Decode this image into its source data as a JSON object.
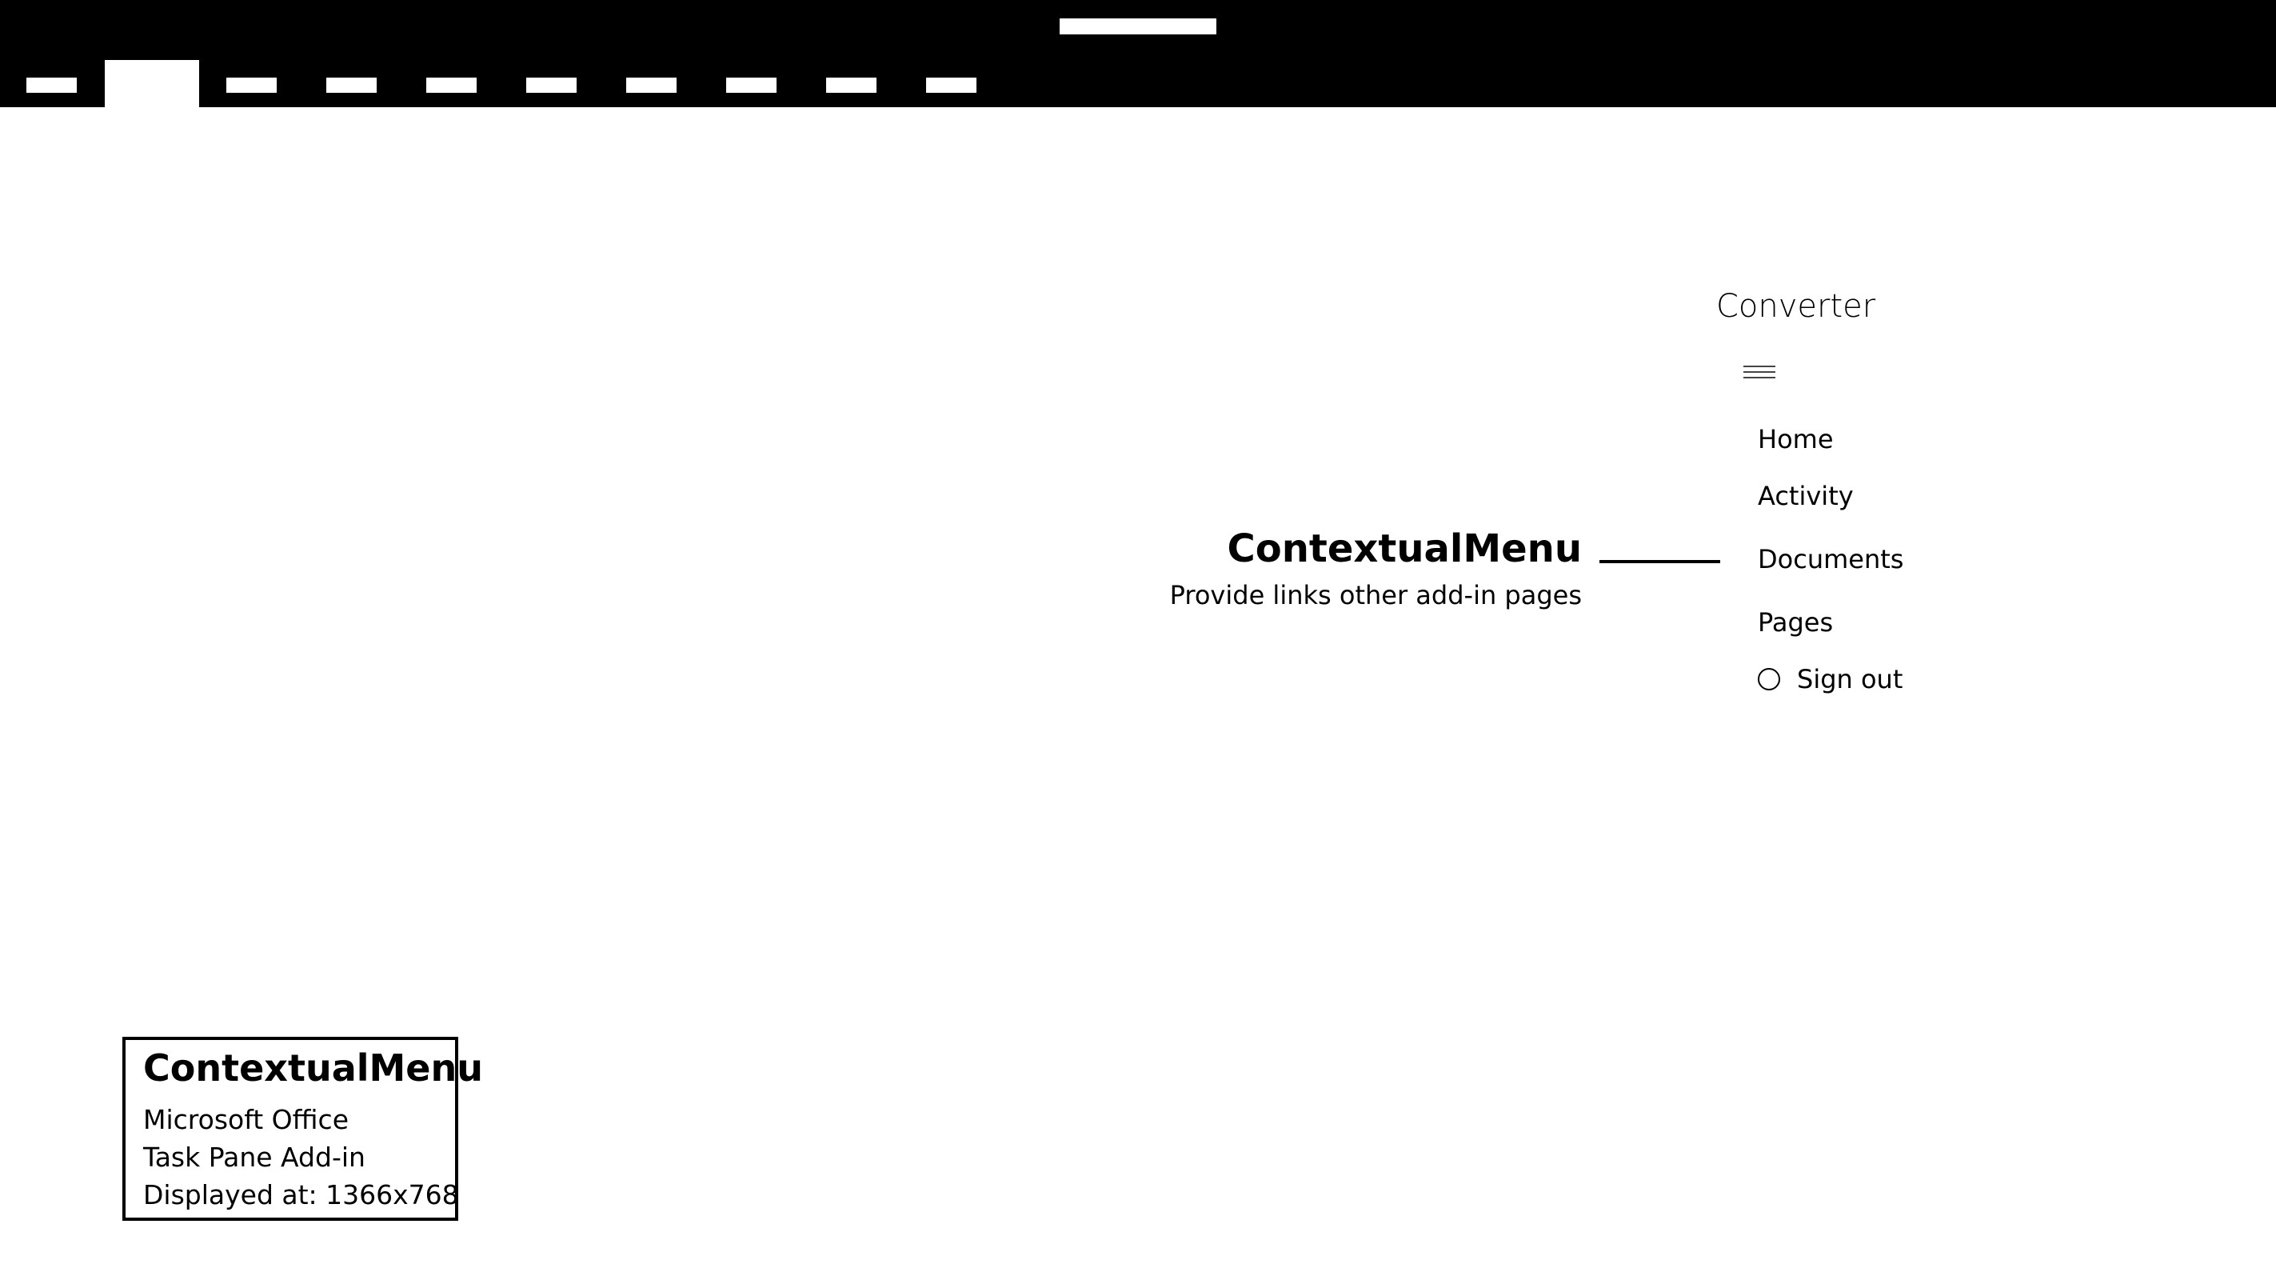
{
  "task_pane": {
    "title": "Converter",
    "menu_items": [
      {
        "label": "Home"
      },
      {
        "label": "Activity"
      },
      {
        "label": "Documents"
      },
      {
        "label": "Pages"
      }
    ],
    "sign_out_label": "Sign out"
  },
  "callout": {
    "title": "ContextualMenu",
    "description": "Provide links other add-in pages"
  },
  "info_box": {
    "title": "ContextualMenu",
    "lines": [
      "Microsoft Office",
      "Task Pane Add-in",
      "Displayed at: 1366x768"
    ]
  }
}
